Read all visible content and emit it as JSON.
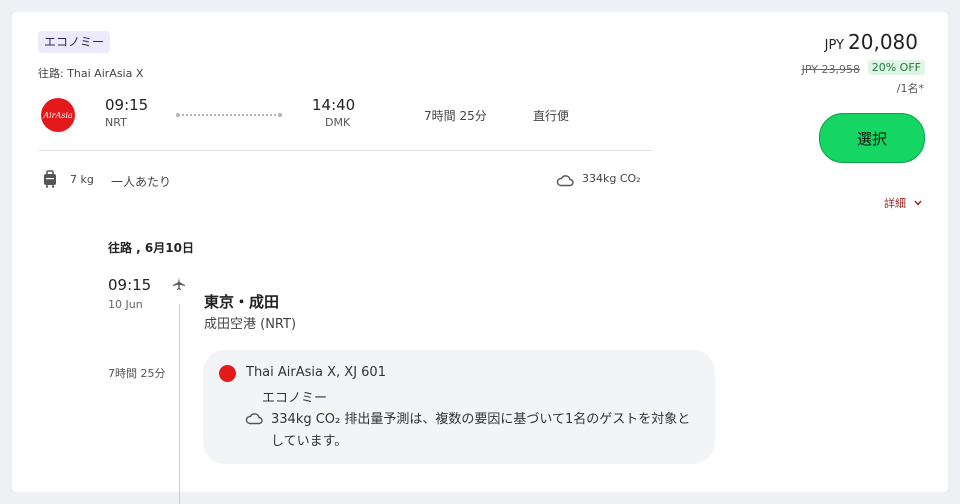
{
  "badge": "エコノミー",
  "route_label": "往路: Thai AirAsia X",
  "airline_logo_text": "AirAsia",
  "departure": {
    "time": "09:15",
    "code": "NRT"
  },
  "arrival": {
    "time": "14:40",
    "code": "DMK"
  },
  "duration": "7時間 25分",
  "stops": "直行便",
  "baggage": {
    "weight": "7 kg",
    "note": "一人あたり"
  },
  "co2_summary": "334kg CO₂",
  "price": {
    "currency": "JPY",
    "amount": "20,080",
    "original": "JPY 23,958",
    "discount": "20% OFF",
    "per": "/1名*"
  },
  "select_label": "選択",
  "details_label": "詳細",
  "itinerary": {
    "header": "往路 , 6月10日",
    "dep_time": "09:15",
    "dep_date": "10 Jun",
    "city": "東京・成田",
    "airport": "成田空港 (NRT)",
    "duration": "7時間 25分",
    "flight": "Thai AirAsia X, XJ 601",
    "cabin": "エコノミー",
    "co2_text": "334kg CO₂ 排出量予測は、複数の要因に基づいて1名のゲストを対象としています。"
  },
  "colors": {
    "select_button": "#15d662",
    "discount_bg": "#dff5e5",
    "airline_red": "#e3191b",
    "details": "#9c2424"
  },
  "icons": [
    "luggage-icon",
    "cloud-icon",
    "plane-icon",
    "chevron-down-icon"
  ]
}
